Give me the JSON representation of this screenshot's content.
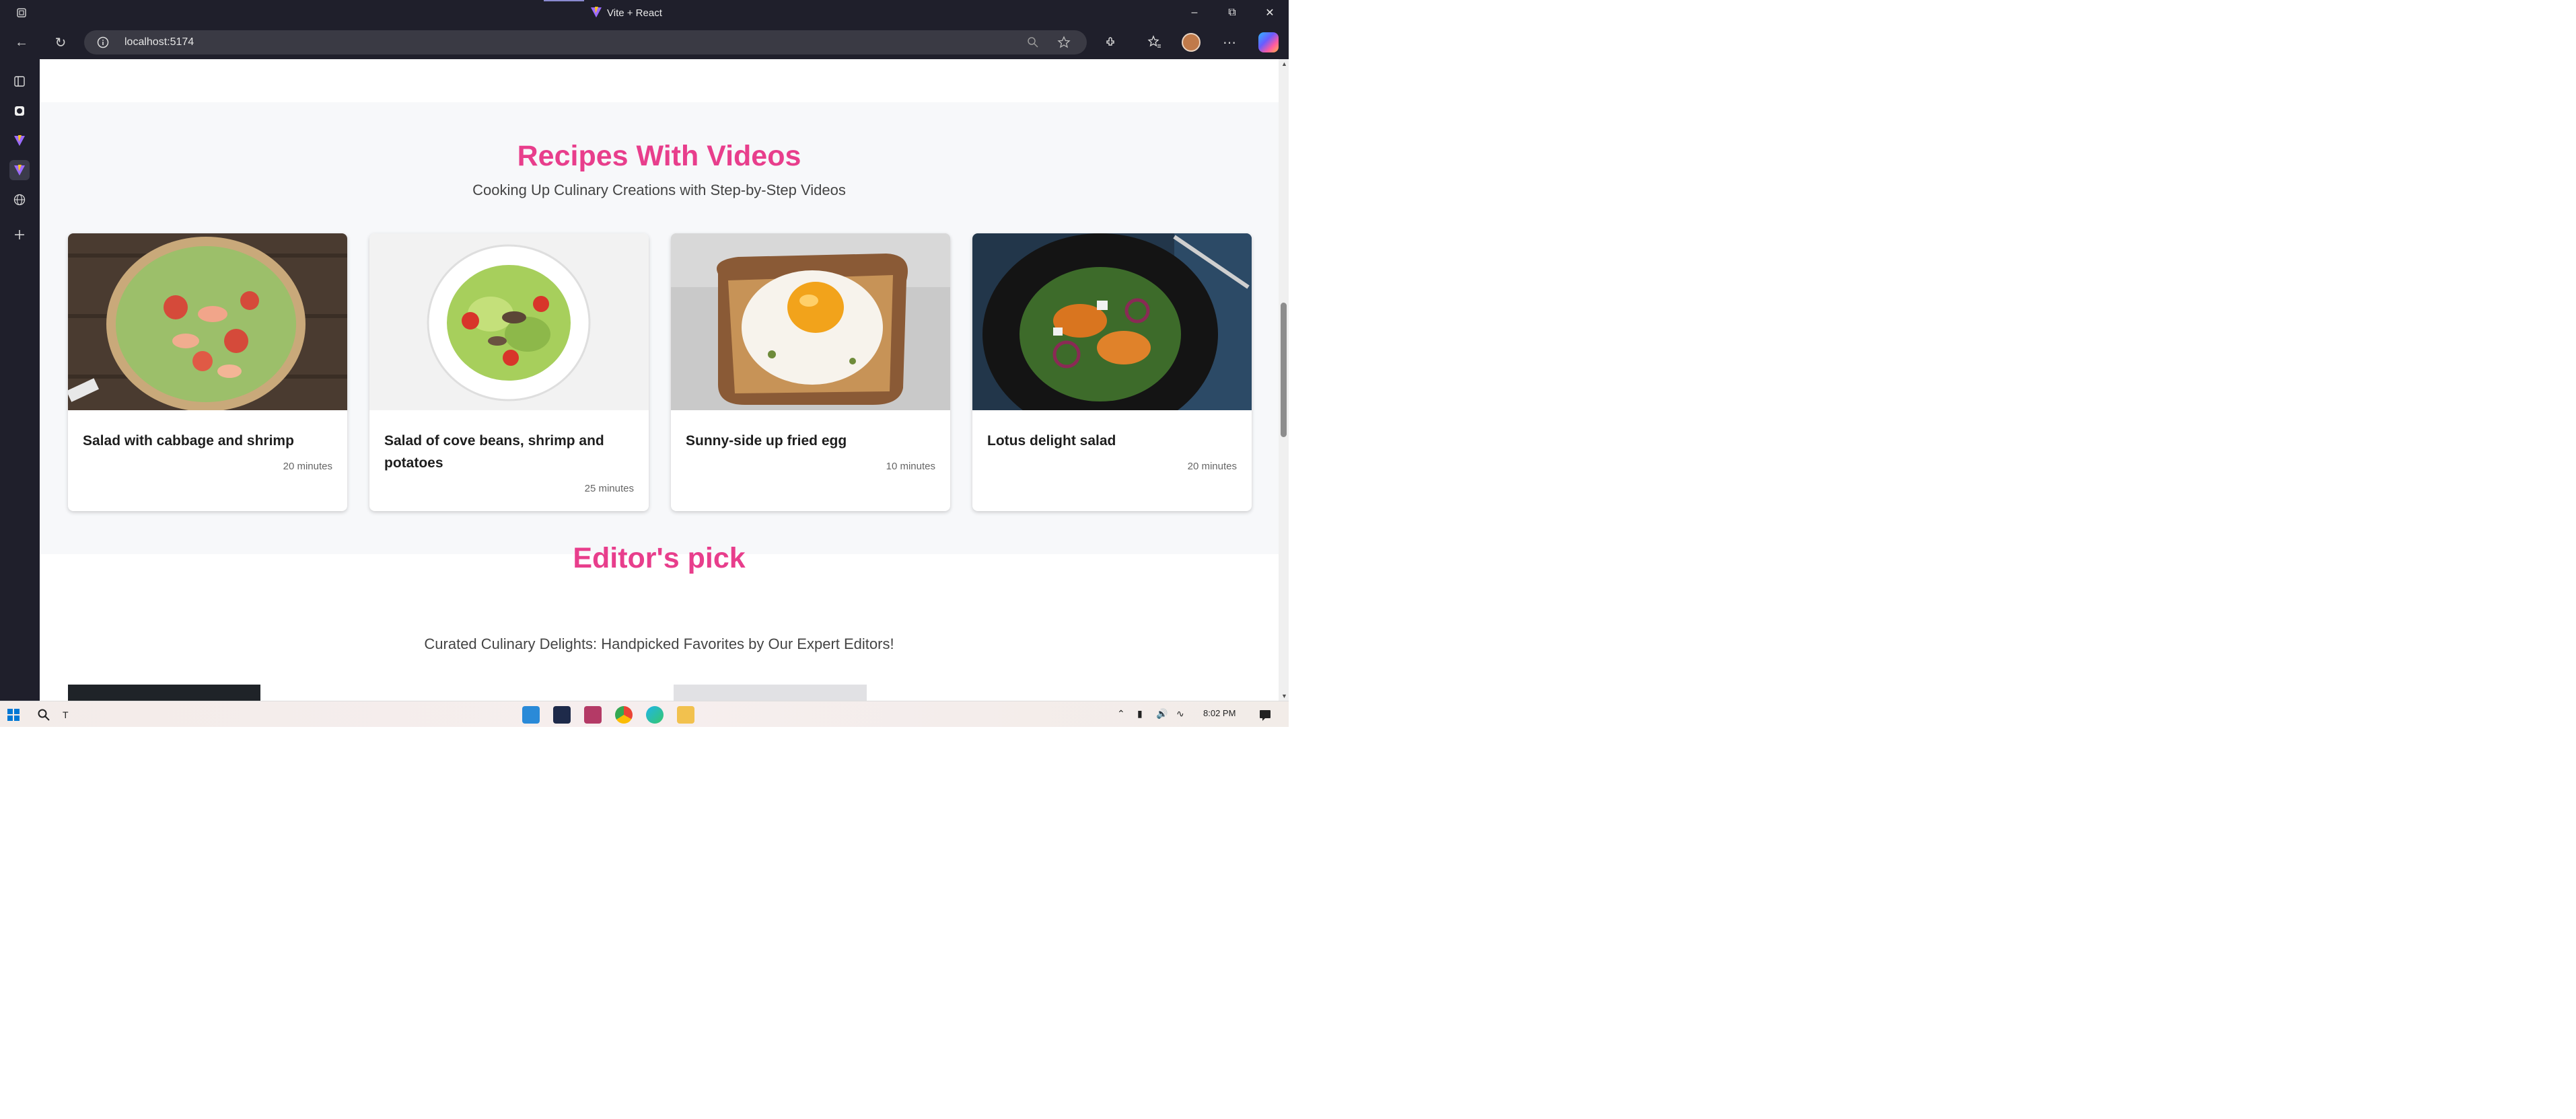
{
  "browser": {
    "window_title": "Vite + React",
    "url": "localhost:5174"
  },
  "sections": {
    "videos": {
      "title": "Recipes With Videos",
      "subtitle": "Cooking Up Culinary Creations with Step-by-Step Videos",
      "cards": [
        {
          "name": "Salad with cabbage and shrimp",
          "time": "20 minutes"
        },
        {
          "name": "Salad of cove beans, shrimp and potatoes",
          "time": "25 minutes"
        },
        {
          "name": "Sunny-side up fried egg",
          "time": "10 minutes"
        },
        {
          "name": "Lotus delight salad",
          "time": "20 minutes"
        }
      ]
    },
    "editors": {
      "title": "Editor's pick",
      "subtitle": "Curated Culinary Delights: Handpicked Favorites by Our Expert Editors!"
    }
  },
  "taskbar": {
    "search_text": "T",
    "clock": "8:02 PM"
  },
  "colors": {
    "accent": "#e83e8c",
    "browser_chrome": "#1f1f2b"
  }
}
